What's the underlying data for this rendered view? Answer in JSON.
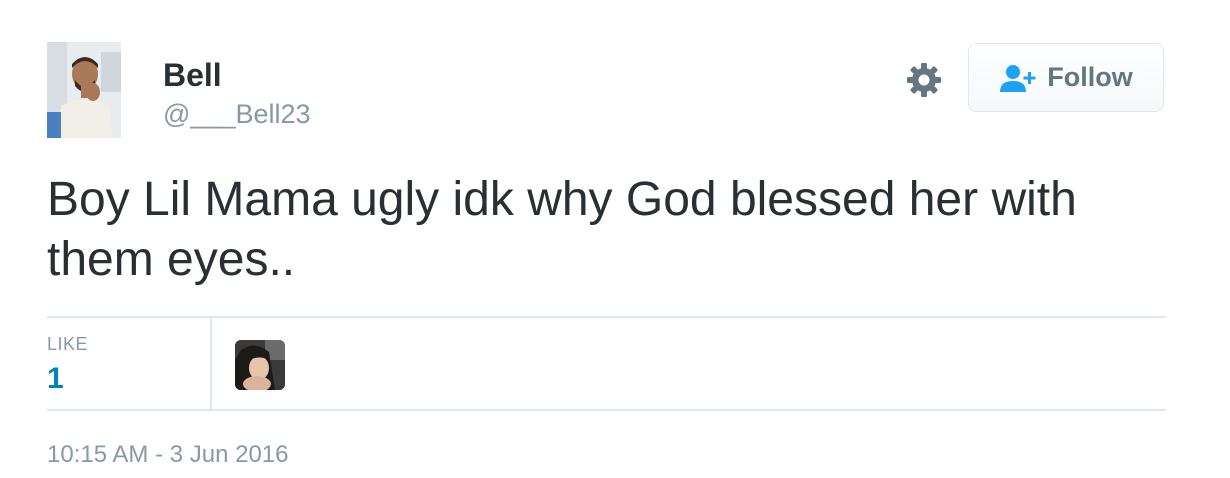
{
  "user": {
    "name": "Bell",
    "handle": "@___Bell23"
  },
  "actions": {
    "settings_icon": "gear-icon",
    "follow_icon": "person-plus-icon",
    "follow_label": "Follow"
  },
  "tweet": {
    "text": "Boy Lil Mama ugly idk why God blessed her with them eyes..",
    "timestamp": "10:15 AM - 3 Jun 2016"
  },
  "stats": {
    "like_label": "LIKE",
    "like_count": "1"
  },
  "colors": {
    "text": "#292f33",
    "muted": "#8899a6",
    "link_blue": "#0084b4",
    "follow_icon_blue": "#1da1f2",
    "border": "#e1e8ed"
  }
}
